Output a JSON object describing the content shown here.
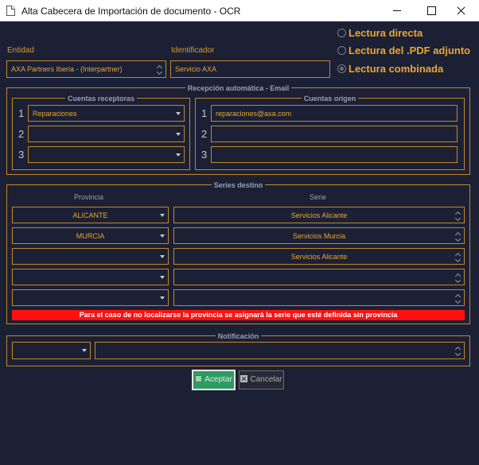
{
  "window": {
    "title": "Alta Cabecera de Importación de documento - OCR"
  },
  "entidad": {
    "label": "Entidad",
    "value": "AXA Partners Iberia - (Interpartner)"
  },
  "identificador": {
    "label": "Identificador",
    "value": "Servicio AXA"
  },
  "lectura": {
    "options": [
      "Lectura directa",
      "Lectura del .PDF adjunto",
      "Lectura combinada"
    ],
    "selected": "Lectura combinada"
  },
  "recepcion": {
    "title": "Recepción automática - Email",
    "receptoras": {
      "title": "Cuentas receptoras",
      "rows": [
        {
          "num": "1",
          "value": "Reparaciones"
        },
        {
          "num": "2",
          "value": ""
        },
        {
          "num": "3",
          "value": ""
        }
      ]
    },
    "origen": {
      "title": "Cuentas origen",
      "rows": [
        {
          "num": "1",
          "value": "reparaciones@axa.com"
        },
        {
          "num": "2",
          "value": ""
        },
        {
          "num": "3",
          "value": ""
        }
      ]
    }
  },
  "series": {
    "title": "Series destino",
    "col_provincia": "Provincia",
    "col_serie": "Serie",
    "rows": [
      {
        "provincia": "ALICANTE",
        "serie": "Servicios Alicante"
      },
      {
        "provincia": "MURCIA",
        "serie": "Servicios Murcia"
      },
      {
        "provincia": "",
        "serie": "Servicios Alicante"
      },
      {
        "provincia": "",
        "serie": ""
      },
      {
        "provincia": "",
        "serie": ""
      }
    ],
    "warning": "Para el caso de no localizarse la provincia se asignará la serie que esté definida sin provincia"
  },
  "notificacion": {
    "title": "Notificación",
    "select_value": "",
    "text_value": ""
  },
  "buttons": {
    "accept": "Aceptar",
    "cancel": "Cancelar"
  },
  "colors": {
    "background": "#1b2035",
    "accent": "#e9a632",
    "border": "#c2882a",
    "warning_bg": "#ff1010",
    "accept_bg": "#2e9c62"
  }
}
